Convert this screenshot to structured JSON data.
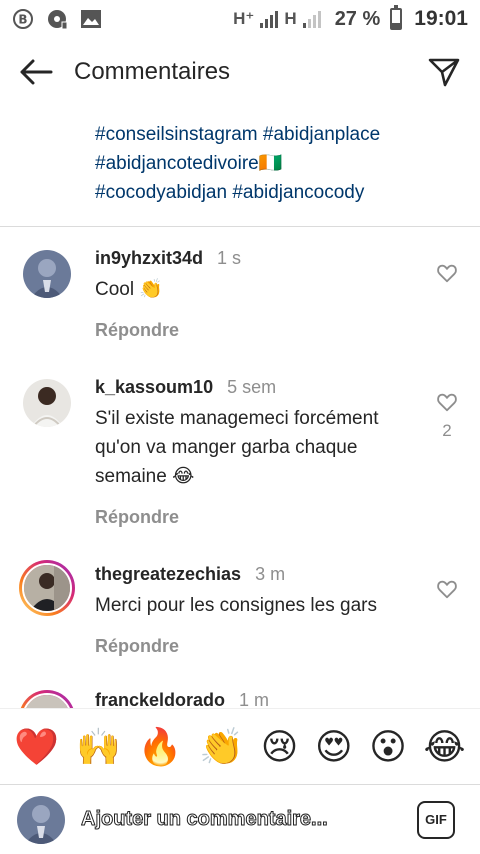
{
  "status_bar": {
    "network_1": "H⁺",
    "network_2": "H",
    "battery": "27 %",
    "battery_level": 0.27,
    "time": "19:01",
    "left_icons": [
      "b-circle-icon",
      "cd-icon",
      "image-icon"
    ]
  },
  "header": {
    "title": "Commentaires",
    "back_icon": "arrow-left-icon",
    "send_icon": "paper-plane-icon"
  },
  "caption": {
    "lines": [
      "#conseilsinstagram #abidjanplace",
      "#abidjancotedivoire🇨🇮",
      "#cocodyabidjan #abidjancocody"
    ]
  },
  "comments": [
    {
      "username": "in9yhzxit34d",
      "time": "1 s",
      "text": "Cool 👏",
      "reply": "Répondre",
      "likes": ""
    },
    {
      "username": "k_kassoum10",
      "time": "5 sem",
      "text": "S'il existe managemeci forcément qu'on va manger garba chaque semaine 😂",
      "reply": "Répondre",
      "likes": "2"
    },
    {
      "username": "thegreatezechias",
      "time": "3 m",
      "text": "Merci pour les consignes les gars",
      "reply": "Répondre",
      "likes": ""
    },
    {
      "username": "franckeldorado",
      "time": "1 m",
      "text": "",
      "reply": "",
      "likes": ""
    }
  ],
  "emoji_bar": [
    "❤️",
    "🙌",
    "🔥",
    "👏",
    "😢",
    "😍",
    "😮",
    "😂"
  ],
  "input": {
    "placeholder": "Ajouter un commentaire...",
    "value": "",
    "gif_label": "GIF"
  },
  "colors": {
    "hashtag": "#00376b",
    "secondary_text": "#8e8e8e",
    "divider": "#dbdbdb"
  }
}
